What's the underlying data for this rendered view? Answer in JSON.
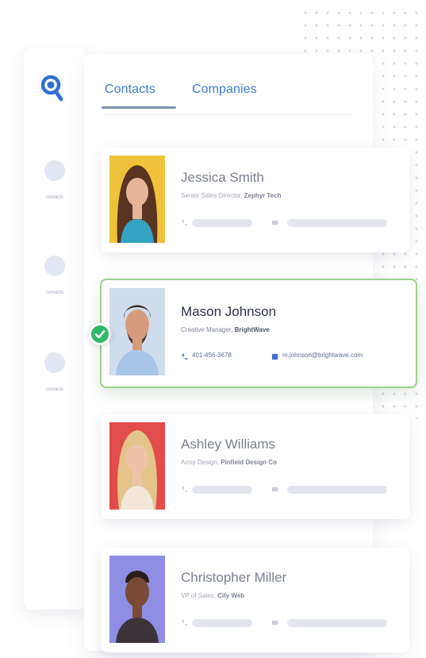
{
  "tabs": [
    {
      "label": "Contacts",
      "active": true
    },
    {
      "label": "Companies",
      "active": false
    }
  ],
  "sidebar": {
    "items": [
      {
        "label": "contacts"
      },
      {
        "label": "contacts"
      },
      {
        "label": "contacts"
      }
    ]
  },
  "contacts": [
    {
      "name": "Jessica Smith",
      "title": "Senior Sales Director, ",
      "company": "Zephyr Tech",
      "photo_bg": "#f0c23a",
      "selected": false
    },
    {
      "name": "Mason Johnson",
      "title": "Creative Manager, ",
      "company": "BrightWave",
      "phone": "401-456-3678",
      "email": "m.johnson@brightwave.com",
      "photo_bg": "#cfdcec",
      "selected": true
    },
    {
      "name": "Ashley Williams",
      "title": "Army Design, ",
      "company": "Pinfield Design Co",
      "photo_bg": "#e24c4c",
      "selected": false
    },
    {
      "name": "Christopher Miller",
      "title": "VP of Sales, ",
      "company": "City Web",
      "photo_bg": "#8f8ee4",
      "selected": false
    }
  ],
  "colors": {
    "accent": "#3a7bd5",
    "selected_border": "#9cd18a",
    "check": "#2fb86a"
  }
}
